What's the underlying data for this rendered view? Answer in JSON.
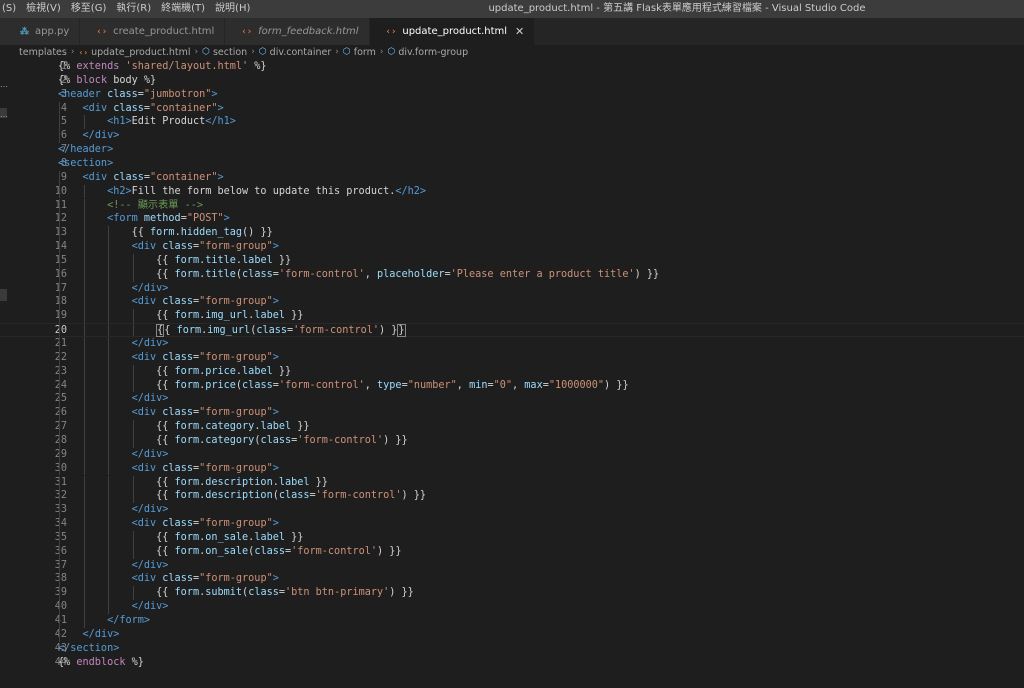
{
  "menu": [
    "(S)",
    "檢視(V)",
    "移至(G)",
    "執行(R)",
    "終端機(T)",
    "說明(H)"
  ],
  "window_title": "update_product.html - 第五講 Flask表單應用程式練習檔案 - Visual Studio Code",
  "tabs": [
    {
      "label": "app.py",
      "icon": "python-file-icon",
      "glyph": "⁂",
      "kind": "py",
      "italic": false,
      "active": false
    },
    {
      "label": "create_product.html",
      "icon": "html-file-icon",
      "glyph": "‹›",
      "kind": "html",
      "italic": false,
      "active": false
    },
    {
      "label": "form_feedback.html",
      "icon": "html-file-icon",
      "glyph": "‹›",
      "kind": "html",
      "italic": true,
      "active": false
    },
    {
      "label": "update_product.html",
      "icon": "html-file-icon",
      "glyph": "‹›",
      "kind": "html",
      "italic": false,
      "active": true,
      "close": "✕"
    }
  ],
  "breadcrumb": [
    "templates",
    "update_product.html",
    "section",
    "div.container",
    "form",
    "div.form-group"
  ],
  "current_line": 20,
  "code_lines": [
    [
      [
        "{% ",
        "tk-jinja"
      ],
      [
        "extends",
        "tk-kw"
      ],
      [
        " ",
        "tk-txt"
      ],
      [
        "'shared/layout.html'",
        "tk-str"
      ],
      [
        " %}",
        "tk-jinja"
      ]
    ],
    [
      [
        "{% ",
        "tk-jinja"
      ],
      [
        "block",
        "tk-kw"
      ],
      [
        " body ",
        "tk-jinja"
      ],
      [
        "%}",
        "tk-jinja"
      ]
    ],
    [
      [
        "<header",
        "tk-tag"
      ],
      [
        " class",
        "tk-attr"
      ],
      [
        "=",
        "tk-txt"
      ],
      [
        "\"jumbotron\"",
        "tk-str"
      ],
      [
        ">",
        "tk-tag"
      ]
    ],
    [
      [
        "    ",
        "tk-txt"
      ],
      [
        "<div",
        "tk-tag"
      ],
      [
        " class",
        "tk-attr"
      ],
      [
        "=",
        "tk-txt"
      ],
      [
        "\"container\"",
        "tk-str"
      ],
      [
        ">",
        "tk-tag"
      ]
    ],
    [
      [
        "        ",
        "tk-txt"
      ],
      [
        "<h1>",
        "tk-tag"
      ],
      [
        "Edit Product",
        "tk-txt"
      ],
      [
        "</h1>",
        "tk-tag"
      ]
    ],
    [
      [
        "    ",
        "tk-txt"
      ],
      [
        "</div>",
        "tk-tag"
      ]
    ],
    [
      [
        "</header>",
        "tk-tag"
      ]
    ],
    [
      [
        "<section>",
        "tk-tag"
      ]
    ],
    [
      [
        "    ",
        "tk-txt"
      ],
      [
        "<div",
        "tk-tag"
      ],
      [
        " class",
        "tk-attr"
      ],
      [
        "=",
        "tk-txt"
      ],
      [
        "\"container\"",
        "tk-str"
      ],
      [
        ">",
        "tk-tag"
      ]
    ],
    [
      [
        "        ",
        "tk-txt"
      ],
      [
        "<h2>",
        "tk-tag"
      ],
      [
        "Fill the form below to update this product.",
        "tk-txt"
      ],
      [
        "</h2>",
        "tk-tag"
      ]
    ],
    [
      [
        "        ",
        "tk-txt"
      ],
      [
        "<!-- 顯示表單 -->",
        "tk-cmt"
      ]
    ],
    [
      [
        "        ",
        "tk-txt"
      ],
      [
        "<form",
        "tk-tag"
      ],
      [
        " method",
        "tk-attr"
      ],
      [
        "=",
        "tk-txt"
      ],
      [
        "\"POST\"",
        "tk-str"
      ],
      [
        ">",
        "tk-tag"
      ]
    ],
    [
      [
        "            ",
        "tk-txt"
      ],
      [
        "{{ ",
        "tk-jinja"
      ],
      [
        "form",
        "tk-var"
      ],
      [
        ".",
        "tk-txt"
      ],
      [
        "hidden_tag",
        "tk-var"
      ],
      [
        "() }}",
        "tk-jinja"
      ]
    ],
    [
      [
        "            ",
        "tk-txt"
      ],
      [
        "<div",
        "tk-tag"
      ],
      [
        " class",
        "tk-attr"
      ],
      [
        "=",
        "tk-txt"
      ],
      [
        "\"form-group\"",
        "tk-str"
      ],
      [
        ">",
        "tk-tag"
      ]
    ],
    [
      [
        "                ",
        "tk-txt"
      ],
      [
        "{{ ",
        "tk-jinja"
      ],
      [
        "form",
        "tk-var"
      ],
      [
        ".",
        "tk-txt"
      ],
      [
        "title",
        "tk-var"
      ],
      [
        ".",
        "tk-txt"
      ],
      [
        "label",
        "tk-var"
      ],
      [
        " }}",
        "tk-jinja"
      ]
    ],
    [
      [
        "                ",
        "tk-txt"
      ],
      [
        "{{ ",
        "tk-jinja"
      ],
      [
        "form",
        "tk-var"
      ],
      [
        ".",
        "tk-txt"
      ],
      [
        "title",
        "tk-var"
      ],
      [
        "(",
        "tk-txt"
      ],
      [
        "class",
        "tk-var"
      ],
      [
        "=",
        "tk-txt"
      ],
      [
        "'form-control'",
        "tk-str"
      ],
      [
        ", ",
        "tk-txt"
      ],
      [
        "placeholder",
        "tk-var"
      ],
      [
        "=",
        "tk-txt"
      ],
      [
        "'Please enter a product title'",
        "tk-str"
      ],
      [
        ") }}",
        "tk-jinja"
      ]
    ],
    [
      [
        "            ",
        "tk-txt"
      ],
      [
        "</div>",
        "tk-tag"
      ]
    ],
    [
      [
        "            ",
        "tk-txt"
      ],
      [
        "<div",
        "tk-tag"
      ],
      [
        " class",
        "tk-attr"
      ],
      [
        "=",
        "tk-txt"
      ],
      [
        "\"form-group\"",
        "tk-str"
      ],
      [
        ">",
        "tk-tag"
      ]
    ],
    [
      [
        "                ",
        "tk-txt"
      ],
      [
        "{{ ",
        "tk-jinja"
      ],
      [
        "form",
        "tk-var"
      ],
      [
        ".",
        "tk-txt"
      ],
      [
        "img_url",
        "tk-var"
      ],
      [
        ".",
        "tk-txt"
      ],
      [
        "label",
        "tk-var"
      ],
      [
        " }}",
        "tk-jinja"
      ]
    ],
    [
      [
        "                ",
        "tk-txt"
      ],
      [
        "{",
        "tk-bracket"
      ],
      [
        "{ ",
        "tk-jinja"
      ],
      [
        "form",
        "tk-var"
      ],
      [
        ".",
        "tk-txt"
      ],
      [
        "img_url",
        "tk-var"
      ],
      [
        "(",
        "tk-txt"
      ],
      [
        "class",
        "tk-var"
      ],
      [
        "=",
        "tk-txt"
      ],
      [
        "'form-control'",
        "tk-str"
      ],
      [
        ") }",
        "tk-jinja"
      ],
      [
        "}",
        "tk-bracket"
      ]
    ],
    [
      [
        "            ",
        "tk-txt"
      ],
      [
        "</div>",
        "tk-tag"
      ]
    ],
    [
      [
        "            ",
        "tk-txt"
      ],
      [
        "<div",
        "tk-tag"
      ],
      [
        " class",
        "tk-attr"
      ],
      [
        "=",
        "tk-txt"
      ],
      [
        "\"form-group\"",
        "tk-str"
      ],
      [
        ">",
        "tk-tag"
      ]
    ],
    [
      [
        "                ",
        "tk-txt"
      ],
      [
        "{{ ",
        "tk-jinja"
      ],
      [
        "form",
        "tk-var"
      ],
      [
        ".",
        "tk-txt"
      ],
      [
        "price",
        "tk-var"
      ],
      [
        ".",
        "tk-txt"
      ],
      [
        "label",
        "tk-var"
      ],
      [
        " }}",
        "tk-jinja"
      ]
    ],
    [
      [
        "                ",
        "tk-txt"
      ],
      [
        "{{ ",
        "tk-jinja"
      ],
      [
        "form",
        "tk-var"
      ],
      [
        ".",
        "tk-txt"
      ],
      [
        "price",
        "tk-var"
      ],
      [
        "(",
        "tk-txt"
      ],
      [
        "class",
        "tk-var"
      ],
      [
        "=",
        "tk-txt"
      ],
      [
        "'form-control'",
        "tk-str"
      ],
      [
        ", ",
        "tk-txt"
      ],
      [
        "type",
        "tk-var"
      ],
      [
        "=",
        "tk-txt"
      ],
      [
        "\"number\"",
        "tk-str"
      ],
      [
        ", ",
        "tk-txt"
      ],
      [
        "min",
        "tk-var"
      ],
      [
        "=",
        "tk-txt"
      ],
      [
        "\"0\"",
        "tk-str"
      ],
      [
        ", ",
        "tk-txt"
      ],
      [
        "max",
        "tk-var"
      ],
      [
        "=",
        "tk-txt"
      ],
      [
        "\"1000000\"",
        "tk-str"
      ],
      [
        ") }}",
        "tk-jinja"
      ]
    ],
    [
      [
        "            ",
        "tk-txt"
      ],
      [
        "</div>",
        "tk-tag"
      ]
    ],
    [
      [
        "            ",
        "tk-txt"
      ],
      [
        "<div",
        "tk-tag"
      ],
      [
        " class",
        "tk-attr"
      ],
      [
        "=",
        "tk-txt"
      ],
      [
        "\"form-group\"",
        "tk-str"
      ],
      [
        ">",
        "tk-tag"
      ]
    ],
    [
      [
        "                ",
        "tk-txt"
      ],
      [
        "{{ ",
        "tk-jinja"
      ],
      [
        "form",
        "tk-var"
      ],
      [
        ".",
        "tk-txt"
      ],
      [
        "category",
        "tk-var"
      ],
      [
        ".",
        "tk-txt"
      ],
      [
        "label",
        "tk-var"
      ],
      [
        " }}",
        "tk-jinja"
      ]
    ],
    [
      [
        "                ",
        "tk-txt"
      ],
      [
        "{{ ",
        "tk-jinja"
      ],
      [
        "form",
        "tk-var"
      ],
      [
        ".",
        "tk-txt"
      ],
      [
        "category",
        "tk-var"
      ],
      [
        "(",
        "tk-txt"
      ],
      [
        "class",
        "tk-var"
      ],
      [
        "=",
        "tk-txt"
      ],
      [
        "'form-control'",
        "tk-str"
      ],
      [
        ") }}",
        "tk-jinja"
      ]
    ],
    [
      [
        "            ",
        "tk-txt"
      ],
      [
        "</div>",
        "tk-tag"
      ]
    ],
    [
      [
        "            ",
        "tk-txt"
      ],
      [
        "<div",
        "tk-tag"
      ],
      [
        " class",
        "tk-attr"
      ],
      [
        "=",
        "tk-txt"
      ],
      [
        "\"form-group\"",
        "tk-str"
      ],
      [
        ">",
        "tk-tag"
      ]
    ],
    [
      [
        "                ",
        "tk-txt"
      ],
      [
        "{{ ",
        "tk-jinja"
      ],
      [
        "form",
        "tk-var"
      ],
      [
        ".",
        "tk-txt"
      ],
      [
        "description",
        "tk-var"
      ],
      [
        ".",
        "tk-txt"
      ],
      [
        "label",
        "tk-var"
      ],
      [
        " }}",
        "tk-jinja"
      ]
    ],
    [
      [
        "                ",
        "tk-txt"
      ],
      [
        "{{ ",
        "tk-jinja"
      ],
      [
        "form",
        "tk-var"
      ],
      [
        ".",
        "tk-txt"
      ],
      [
        "description",
        "tk-var"
      ],
      [
        "(",
        "tk-txt"
      ],
      [
        "class",
        "tk-var"
      ],
      [
        "=",
        "tk-txt"
      ],
      [
        "'form-control'",
        "tk-str"
      ],
      [
        ") }}",
        "tk-jinja"
      ]
    ],
    [
      [
        "            ",
        "tk-txt"
      ],
      [
        "</div>",
        "tk-tag"
      ]
    ],
    [
      [
        "            ",
        "tk-txt"
      ],
      [
        "<div",
        "tk-tag"
      ],
      [
        " class",
        "tk-attr"
      ],
      [
        "=",
        "tk-txt"
      ],
      [
        "\"form-group\"",
        "tk-str"
      ],
      [
        ">",
        "tk-tag"
      ]
    ],
    [
      [
        "                ",
        "tk-txt"
      ],
      [
        "{{ ",
        "tk-jinja"
      ],
      [
        "form",
        "tk-var"
      ],
      [
        ".",
        "tk-txt"
      ],
      [
        "on_sale",
        "tk-var"
      ],
      [
        ".",
        "tk-txt"
      ],
      [
        "label",
        "tk-var"
      ],
      [
        " }}",
        "tk-jinja"
      ]
    ],
    [
      [
        "                ",
        "tk-txt"
      ],
      [
        "{{ ",
        "tk-jinja"
      ],
      [
        "form",
        "tk-var"
      ],
      [
        ".",
        "tk-txt"
      ],
      [
        "on_sale",
        "tk-var"
      ],
      [
        "(",
        "tk-txt"
      ],
      [
        "class",
        "tk-var"
      ],
      [
        "=",
        "tk-txt"
      ],
      [
        "'form-control'",
        "tk-str"
      ],
      [
        ") }}",
        "tk-jinja"
      ]
    ],
    [
      [
        "            ",
        "tk-txt"
      ],
      [
        "</div>",
        "tk-tag"
      ]
    ],
    [
      [
        "            ",
        "tk-txt"
      ],
      [
        "<div",
        "tk-tag"
      ],
      [
        " class",
        "tk-attr"
      ],
      [
        "=",
        "tk-txt"
      ],
      [
        "\"form-group\"",
        "tk-str"
      ],
      [
        ">",
        "tk-tag"
      ]
    ],
    [
      [
        "                ",
        "tk-txt"
      ],
      [
        "{{ ",
        "tk-jinja"
      ],
      [
        "form",
        "tk-var"
      ],
      [
        ".",
        "tk-txt"
      ],
      [
        "submit",
        "tk-var"
      ],
      [
        "(",
        "tk-txt"
      ],
      [
        "class",
        "tk-var"
      ],
      [
        "=",
        "tk-txt"
      ],
      [
        "'btn btn-primary'",
        "tk-str"
      ],
      [
        ") }}",
        "tk-jinja"
      ]
    ],
    [
      [
        "            ",
        "tk-txt"
      ],
      [
        "</div>",
        "tk-tag"
      ]
    ],
    [
      [
        "        ",
        "tk-txt"
      ],
      [
        "</form>",
        "tk-tag"
      ]
    ],
    [
      [
        "    ",
        "tk-txt"
      ],
      [
        "</div>",
        "tk-tag"
      ]
    ],
    [
      [
        "</section>",
        "tk-tag"
      ]
    ],
    [
      [
        "{% ",
        "tk-jinja"
      ],
      [
        "endblock",
        "tk-kw"
      ],
      [
        " %}",
        "tk-jinja"
      ]
    ]
  ]
}
